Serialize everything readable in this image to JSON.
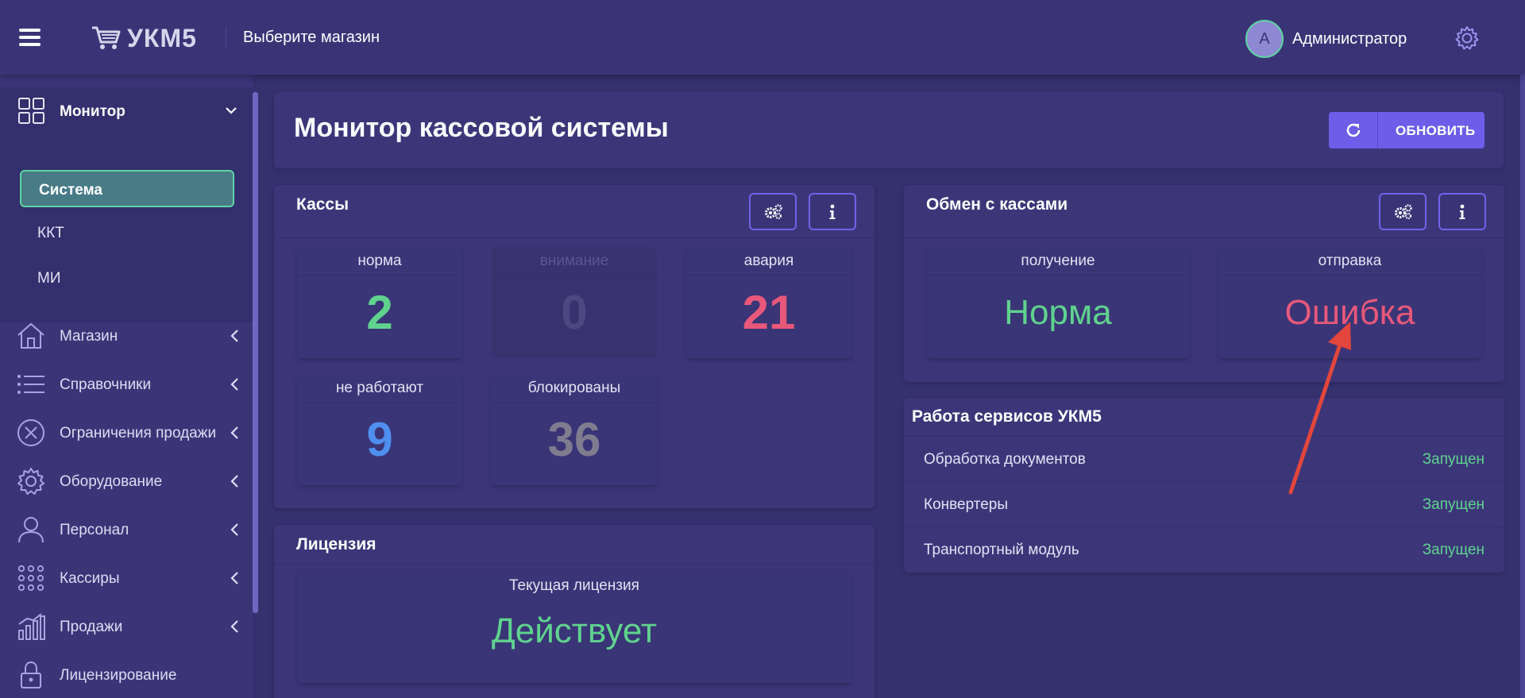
{
  "header": {
    "logo_text": "УКМ5",
    "store_select": "Выберите магазин",
    "avatar_letter": "А",
    "username": "Администратор"
  },
  "sidebar": {
    "monitor": {
      "label": "Монитор",
      "subitems": [
        {
          "label": "Система",
          "active": true
        },
        {
          "label": "ККТ",
          "active": false
        },
        {
          "label": "МИ",
          "active": false
        }
      ]
    },
    "items": [
      {
        "label": "Магазин",
        "icon": "store-icon"
      },
      {
        "label": "Справочники",
        "icon": "list-icon"
      },
      {
        "label": "Ограничения продажи",
        "icon": "restriction-icon"
      },
      {
        "label": "Оборудование",
        "icon": "gear-icon"
      },
      {
        "label": "Персонал",
        "icon": "person-icon"
      },
      {
        "label": "Кассиры",
        "icon": "grid-dots-icon"
      },
      {
        "label": "Продажи",
        "icon": "chart-icon"
      },
      {
        "label": "Лицензирование",
        "icon": "lock-icon"
      }
    ]
  },
  "main": {
    "title": "Монитор кассовой системы",
    "refresh_label": "ОБНОВИТЬ",
    "registers": {
      "title": "Кассы",
      "tiles": [
        {
          "label": "норма",
          "value": "2",
          "color": "#5fd38e"
        },
        {
          "label": "внимание",
          "value": "0",
          "color": "#4d4882"
        },
        {
          "label": "авария",
          "value": "21",
          "color": "#e7587a"
        },
        {
          "label": "не работают",
          "value": "9",
          "color": "#4f8ff0"
        },
        {
          "label": "блокированы",
          "value": "36",
          "color": "#807c90"
        }
      ]
    },
    "license": {
      "title": "Лицензия",
      "current_label": "Текущая лицензия",
      "status": "Действует",
      "status_color": "#5fd38e"
    },
    "exchange": {
      "title": "Обмен с кассами",
      "receive_label": "получение",
      "receive_status": "Норма",
      "receive_color": "#5fd38e",
      "send_label": "отправка",
      "send_status": "Ошибка",
      "send_color": "#e7587a"
    },
    "services": {
      "title": "Работа сервисов УКМ5",
      "rows": [
        {
          "name": "Обработка документов",
          "status": "Запущен"
        },
        {
          "name": "Конвертеры",
          "status": "Запущен"
        },
        {
          "name": "Транспортный модуль",
          "status": "Запущен"
        }
      ]
    }
  },
  "colors": {
    "background": "#35306e",
    "card": "#3c3679",
    "accent": "#6c5ee9",
    "ok": "#5fd38e",
    "error": "#e7587a",
    "annotation_arrow": "#e2463c"
  }
}
